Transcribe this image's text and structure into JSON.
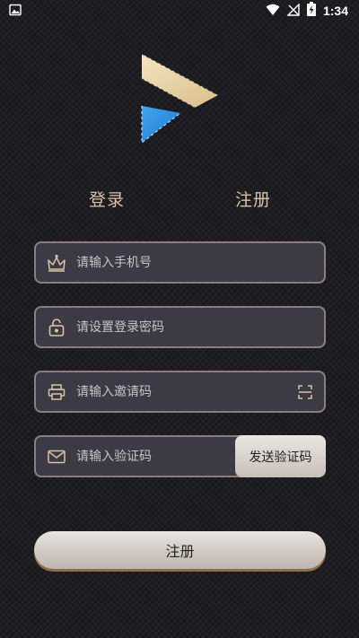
{
  "status_bar": {
    "time": "1:34",
    "icons": [
      "image-icon",
      "wifi-icon",
      "no-signal-icon",
      "battery-charging-icon"
    ]
  },
  "logo": {
    "icon": "play-film-logo-icon",
    "colors": {
      "gold": "#e9d3a3",
      "blue": "#2a8de0"
    }
  },
  "tabs": {
    "login": "登录",
    "register": "注册"
  },
  "form": {
    "phone": {
      "icon": "crown-icon",
      "placeholder": "请输入手机号",
      "value": ""
    },
    "password": {
      "icon": "unlock-icon",
      "placeholder": "请设置登录密码",
      "value": ""
    },
    "invite": {
      "icon": "printer-icon",
      "placeholder": "请输入邀请码",
      "value": "",
      "action_icon": "scan-icon"
    },
    "code": {
      "icon": "mail-icon",
      "placeholder": "请输入验证码",
      "value": "",
      "send_button": "发送验证码"
    }
  },
  "submit": {
    "label": "注册"
  },
  "colors": {
    "accent": "#d8c3a5",
    "field_bg": "#3c3a44",
    "field_border": "#8d7e7e"
  }
}
